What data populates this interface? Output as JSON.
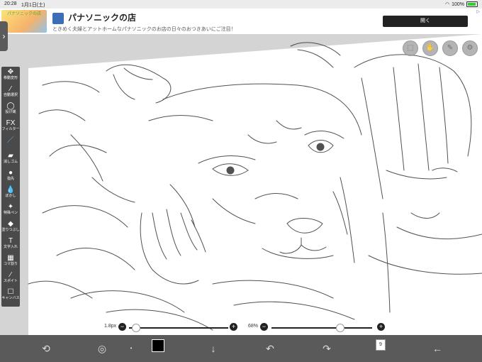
{
  "status": {
    "time": "20:28",
    "date": "1月1日(土)",
    "battery": "100%"
  },
  "ad": {
    "title": "パナソニックの店",
    "description": "ときめく夫婦とアットホームなパナソニックのお店の日々のおつきあいにご注目！",
    "button": "開く",
    "thumb_text": "パナソニックの店",
    "info": "▷"
  },
  "tools": [
    {
      "icon": "✥",
      "label": "移動変形",
      "name": "move-transform-tool"
    },
    {
      "icon": "⁄",
      "label": "自動選択",
      "name": "auto-select-tool"
    },
    {
      "icon": "◯",
      "label": "投げ縄",
      "name": "lasso-tool"
    },
    {
      "icon": "FX",
      "label": "フィルター",
      "name": "filter-tool"
    },
    {
      "icon": "／",
      "label": "",
      "name": "brush-tool"
    },
    {
      "icon": "▰",
      "label": "消しゴム",
      "name": "eraser-tool"
    },
    {
      "icon": "●",
      "label": "指先",
      "name": "smudge-tool"
    },
    {
      "icon": "💧",
      "label": "ぼかし",
      "name": "blur-tool"
    },
    {
      "icon": "✦",
      "label": "特殊ペン",
      "name": "special-pen-tool"
    },
    {
      "icon": "◆",
      "label": "塗りつぶし",
      "name": "fill-tool"
    },
    {
      "icon": "T",
      "label": "文字入れ",
      "name": "text-tool"
    },
    {
      "icon": "▦",
      "label": "コマ割り",
      "name": "panel-tool"
    },
    {
      "icon": "⁄",
      "label": "スポイト",
      "name": "eyedropper-tool"
    },
    {
      "icon": "☐",
      "label": "キャンバス",
      "name": "canvas-tool"
    }
  ],
  "sliders": {
    "brush_size": "1.8px",
    "opacity": "68%"
  },
  "layers": {
    "count": "9"
  },
  "colors": {
    "primary": "#000000"
  }
}
